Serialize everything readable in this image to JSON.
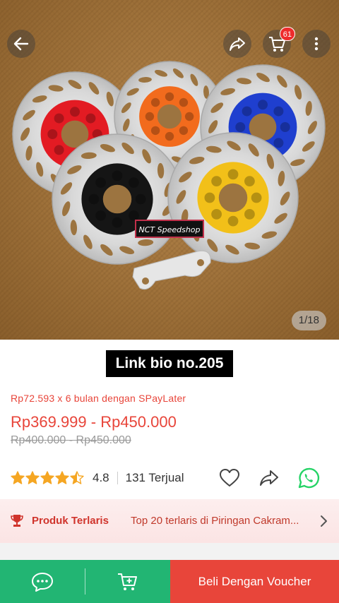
{
  "image": {
    "counter": "1/18",
    "cart_count": "61",
    "brand_sticker": "NCT Speedshop",
    "disc_colors": [
      "#e31b23",
      "#f26b1d",
      "#1f3fcf",
      "#151515",
      "#f2c019"
    ]
  },
  "caption": "Link bio no.205",
  "product": {
    "installment": "Rp72.593 x 6 bulan dengan SPayLater",
    "price": "Rp369.999 - Rp450.000",
    "old_price": "Rp400.000 - Rp450.000",
    "rating": "4.8",
    "rating_stars": 4.5,
    "sold": "131 Terjual"
  },
  "best_seller": {
    "label": "Produk Terlaris",
    "description": "Top 20 terlaris di Piringan Cakram..."
  },
  "bottom_bar": {
    "buy_label": "Beli Dengan Voucher"
  },
  "colors": {
    "accent": "#e8453a",
    "green": "#22b573",
    "star": "#f5a623",
    "whatsapp": "#25d366"
  }
}
